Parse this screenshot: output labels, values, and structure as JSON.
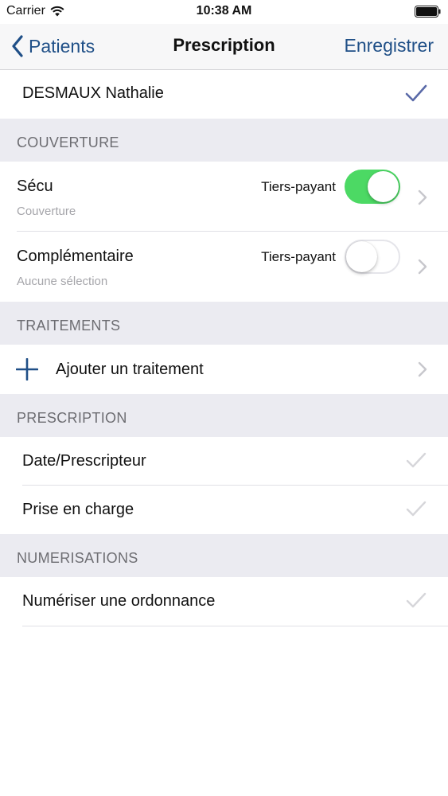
{
  "status_bar": {
    "carrier": "Carrier",
    "time": "10:38 AM"
  },
  "nav": {
    "back_label": "Patients",
    "title": "Prescription",
    "save_label": "Enregistrer"
  },
  "patient": {
    "name": "DESMAUX Nathalie"
  },
  "sections": {
    "coverage": "COUVERTURE",
    "treatments": "TRAITEMENTS",
    "prescription": "PRESCRIPTION",
    "scans": "NUMERISATIONS"
  },
  "coverage": [
    {
      "title": "Sécu",
      "subtitle": "Couverture",
      "toggle_label": "Tiers-payant",
      "toggle_on": true
    },
    {
      "title": "Complémentaire",
      "subtitle": "Aucune sélection",
      "toggle_label": "Tiers-payant",
      "toggle_on": false
    }
  ],
  "treatments": {
    "add_label": "Ajouter un traitement"
  },
  "prescription_items": [
    {
      "label": "Date/Prescripteur"
    },
    {
      "label": "Prise en charge"
    }
  ],
  "scan_items": [
    {
      "label": "Numériser une ordonnance"
    }
  ],
  "colors": {
    "accent": "#1f4f87",
    "toggle_on": "#4cd964",
    "patient_check": "#5a6aa8",
    "light_check": "#d6d6da",
    "section_bg": "#ebebf1"
  }
}
